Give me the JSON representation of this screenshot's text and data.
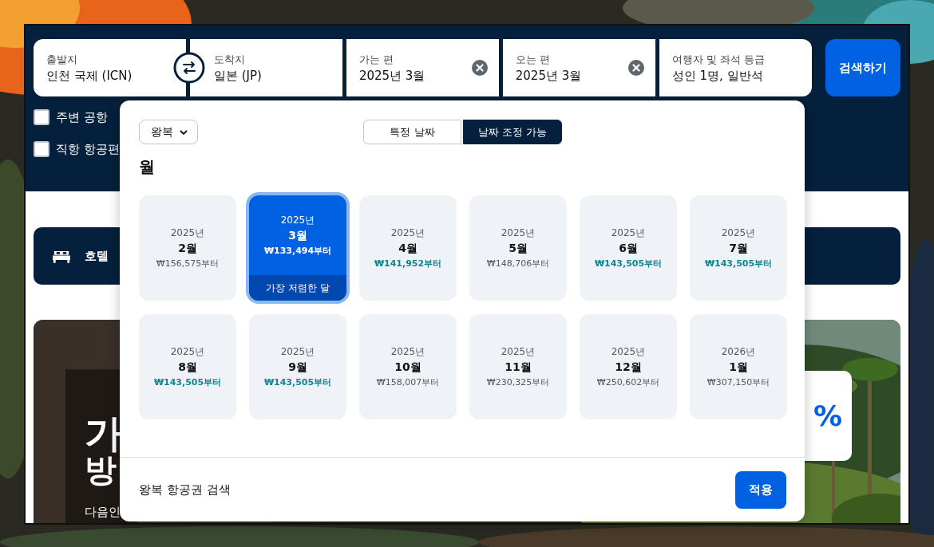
{
  "search_bar": {
    "fields": [
      {
        "label": "출발지",
        "value": "인천 국제 (ICN)",
        "clearable": false
      },
      {
        "label": "도착지",
        "value": "일본 (JP)",
        "clearable": false
      },
      {
        "label": "가는 편",
        "value": "2025년 3월",
        "clearable": true
      },
      {
        "label": "오는 편",
        "value": "2025년 3월",
        "clearable": true
      },
      {
        "label": "여행자 및 좌석 등급",
        "value": "성인 1명, 일반석",
        "clearable": false
      }
    ],
    "search_button": "검색하기"
  },
  "options": [
    {
      "label": "주변 공항",
      "checked": false
    },
    {
      "label": "직항 항공편",
      "checked": false
    }
  ],
  "nav": {
    "label": "호텔"
  },
  "promo": {
    "headline_1": "가",
    "headline_2": "방",
    "subtitle": "다음인",
    "badge": "%"
  },
  "popup": {
    "trip_type": "왕복",
    "modes": [
      {
        "label": "특정 날짜",
        "selected": false
      },
      {
        "label": "날짜 조정 가능",
        "selected": true
      }
    ],
    "heading": "월",
    "months": [
      {
        "year": "2025년",
        "month": "2월",
        "price": "₩156,575부터",
        "deal": false,
        "selected": false
      },
      {
        "year": "2025년",
        "month": "3월",
        "price": "₩133,494부터",
        "deal": true,
        "selected": true,
        "badge": "가장 저렴한 달"
      },
      {
        "year": "2025년",
        "month": "4월",
        "price": "₩141,952부터",
        "deal": true,
        "selected": false
      },
      {
        "year": "2025년",
        "month": "5월",
        "price": "₩148,706부터",
        "deal": false,
        "selected": false
      },
      {
        "year": "2025년",
        "month": "6월",
        "price": "₩143,505부터",
        "deal": true,
        "selected": false
      },
      {
        "year": "2025년",
        "month": "7월",
        "price": "₩143,505부터",
        "deal": true,
        "selected": false
      },
      {
        "year": "2025년",
        "month": "8월",
        "price": "₩143,505부터",
        "deal": true,
        "selected": false
      },
      {
        "year": "2025년",
        "month": "9월",
        "price": "₩143,505부터",
        "deal": true,
        "selected": false
      },
      {
        "year": "2025년",
        "month": "10월",
        "price": "₩158,007부터",
        "deal": false,
        "selected": false
      },
      {
        "year": "2025년",
        "month": "11월",
        "price": "₩230,325부터",
        "deal": false,
        "selected": false
      },
      {
        "year": "2025년",
        "month": "12월",
        "price": "₩250,602부터",
        "deal": false,
        "selected": false
      },
      {
        "year": "2026년",
        "month": "1월",
        "price": "₩307,150부터",
        "deal": false,
        "selected": false
      }
    ],
    "footer_text": "왕복 항공권 검색",
    "apply_button": "적용"
  }
}
